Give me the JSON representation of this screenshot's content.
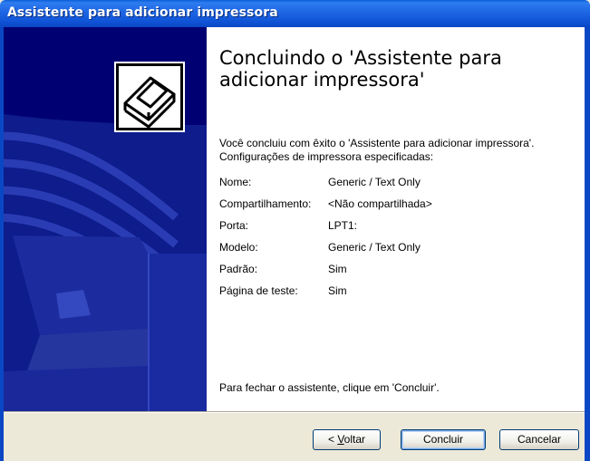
{
  "window": {
    "title": "Assistente para adicionar impressora"
  },
  "heading": "Concluindo o 'Assistente para adicionar impressora'",
  "intro": "Você concluiu com êxito o 'Assistente para adicionar impressora'. Configurações de impressora especificadas:",
  "details": [
    {
      "label": "Nome:",
      "value": "Generic / Text Only"
    },
    {
      "label": "Compartilhamento:",
      "value": "<Não compartilhada>"
    },
    {
      "label": "Porta:",
      "value": "LPT1:"
    },
    {
      "label": "Modelo:",
      "value": "Generic / Text Only"
    },
    {
      "label": "Padrão:",
      "value": "Sim"
    },
    {
      "label": "Página de teste:",
      "value": "Sim"
    }
  ],
  "close_note": "Para fechar o assistente, clique em 'Concluir'.",
  "buttons": {
    "back_prefix": "< ",
    "back_mnemonic": "V",
    "back_rest": "oltar",
    "finish": "Concluir",
    "cancel": "Cancelar"
  },
  "icons": {
    "wizard_icon": "printer-icon"
  },
  "colors": {
    "titlebar": "#0A5FD8",
    "sidebar": "#000072",
    "sidebar_art": "#1C2C9E",
    "background": "#ECE9D8"
  }
}
